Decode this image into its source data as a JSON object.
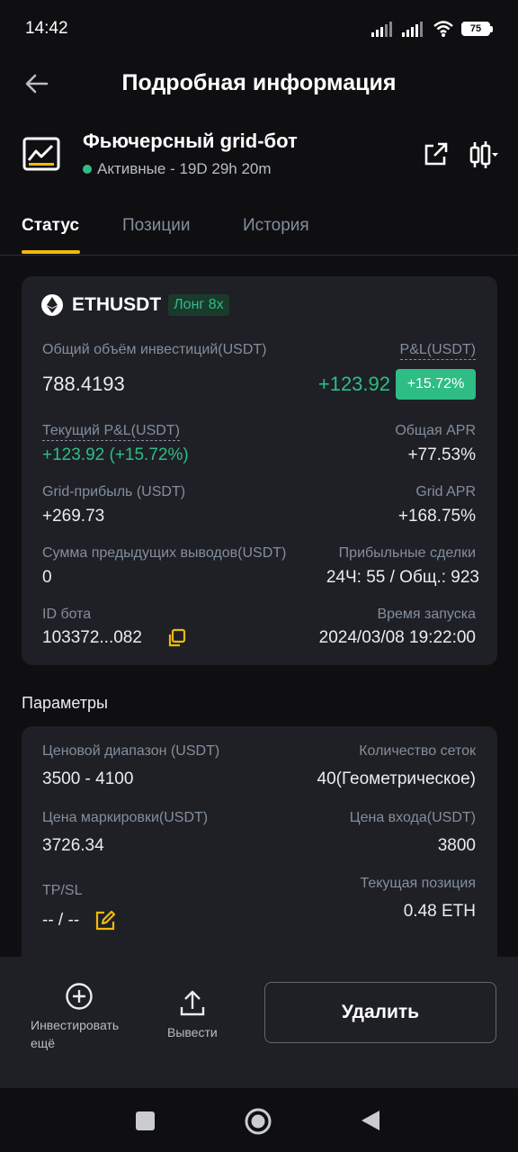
{
  "status_bar": {
    "time": "14:42",
    "battery": "75"
  },
  "header": {
    "title": "Подробная информация"
  },
  "bot": {
    "name": "Фьючерсный grid-бот",
    "status": "Активные - 19D 29h 20m"
  },
  "tabs": [
    {
      "label": "Статус"
    },
    {
      "label": "Позиции"
    },
    {
      "label": "История"
    }
  ],
  "card": {
    "pair": "ETHUSDT",
    "badge": "Лонг 8x",
    "investment_label": "Общий объём инвестиций(USDT)",
    "investment_value": "788.4193",
    "pnl_label": "P&L(USDT)",
    "pnl_value": "+123.92",
    "pnl_percent": "+15.72%",
    "current_pnl_label": "Текущий P&L(USDT)",
    "current_pnl_value": "+123.92 (+15.72%)",
    "total_apr_label": "Общая APR",
    "total_apr_value": "+77.53%",
    "grid_profit_label": "Grid-прибыль (USDT)",
    "grid_profit_value": "+269.73",
    "grid_apr_label": "Grid APR",
    "grid_apr_value": "+168.75%",
    "withdrawals_label": "Сумма предыдущих выводов(USDT)",
    "withdrawals_value": "0",
    "profitable_trades_label": "Прибыльные сделки",
    "profitable_trades_value": "24Ч: 55 / Общ.: 923",
    "bot_id_label": "ID бота",
    "bot_id_value": "103372...082",
    "launch_time_label": "Время запуска",
    "launch_time_value": "2024/03/08 19:22:00"
  },
  "params": {
    "title": "Параметры",
    "price_range_label": "Ценовой диапазон (USDT)",
    "price_range_value": "3500 - 4100",
    "grid_count_label": "Количество сеток",
    "grid_count_value": "40(Геометрическое)",
    "mark_price_label": "Цена маркировки(USDT)",
    "mark_price_value": "3726.34",
    "entry_price_label": "Цена входа(USDT)",
    "entry_price_value": "3800",
    "tpsl_label": "TP/SL",
    "tpsl_value": "-- / --",
    "position_label": "Текущая позиция",
    "position_value": "0.48 ETH"
  },
  "bottom": {
    "invest_more_line1": "Инвестировать",
    "invest_more_line2": "ещё",
    "withdraw": "Вывести",
    "delete": "Удалить"
  },
  "colors": {
    "accent": "#f0b90b",
    "green": "#2ebd85",
    "bg": "#0f0f11",
    "card": "#1e2026"
  }
}
